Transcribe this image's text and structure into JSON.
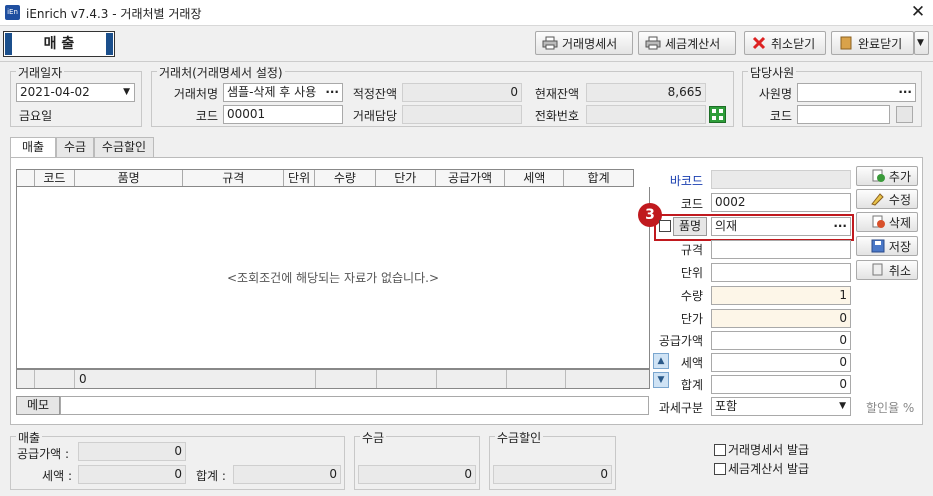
{
  "window": {
    "app_title": "iEnrich v7.4.3 - 거래처별 거래장",
    "logo_text": "iEn"
  },
  "mode_button": "매 출",
  "toolbar": {
    "statement_label": "거래명세서",
    "tax_invoice_label": "세금계산서",
    "cancel_close_label": "취소닫기",
    "done_close_label": "완료닫기"
  },
  "date_group": {
    "title": "거래일자",
    "date": "2021-04-02",
    "weekday": "금요일"
  },
  "client_group": {
    "title": "거래처(거래명세서 설정)",
    "client_label": "거래처명",
    "client_value": "샘플-삭제 후 사용",
    "code_label": "코드",
    "code_value": "00001",
    "proper_balance_label": "적정잔액",
    "proper_balance_value": "0",
    "manager_label": "거래담당",
    "manager_value": "",
    "current_balance_label": "현재잔액",
    "current_balance_value": "8,665",
    "phone_label": "전화번호",
    "phone_value": ""
  },
  "staff_group": {
    "title": "담당사원",
    "name_label": "사원명",
    "name_value": "",
    "code_label": "코드",
    "code_value": ""
  },
  "tabs": [
    "매출",
    "수금",
    "수금할인"
  ],
  "grid": {
    "columns": [
      "코드",
      "품명",
      "규격",
      "단위",
      "수량",
      "단가",
      "공급가액",
      "세액",
      "합계"
    ],
    "empty_message": "<조회조건에 해당되는 자료가 없습니다.>",
    "footer_count": "0"
  },
  "form": {
    "barcode_label": "바코드",
    "barcode_value": "",
    "code_label": "코드",
    "code_value": "0002",
    "item_label": "품명",
    "item_value": "의재",
    "spec_label": "규격",
    "spec_value": "",
    "unit_label": "단위",
    "unit_value": "",
    "qty_label": "수량",
    "qty_value": "1",
    "price_label": "단가",
    "price_value": "0",
    "supply_label": "공급가액",
    "supply_value": "0",
    "tax_label": "세액",
    "tax_value": "0",
    "total_label": "합계",
    "total_value": "0",
    "tax_type_label": "과세구분",
    "tax_type_value": "포함",
    "discount_label": "할인율 %"
  },
  "side_buttons": {
    "add": "추가",
    "edit": "수정",
    "delete": "삭제",
    "save": "저장",
    "cancel": "취소"
  },
  "step_badge": "3",
  "memo": {
    "label": "메모",
    "value": ""
  },
  "bottom": {
    "sales_title": "매출",
    "supply_label": "공급가액 :",
    "supply_value": "0",
    "tax_label": "세액 :",
    "tax_value": "0",
    "total_label": "합계 :",
    "total_value": "0",
    "collect_title": "수금",
    "collect_value": "0",
    "collect_discount_title": "수금할인",
    "collect_discount_value": "0",
    "issue_statement_label": "거래명세서 발급",
    "issue_tax_invoice_label": "세금계산서 발급"
  },
  "colors": {
    "accent": "#1b4f8c",
    "highlight_red": "#c0191e",
    "input_yellow": "#fdf6e8"
  }
}
